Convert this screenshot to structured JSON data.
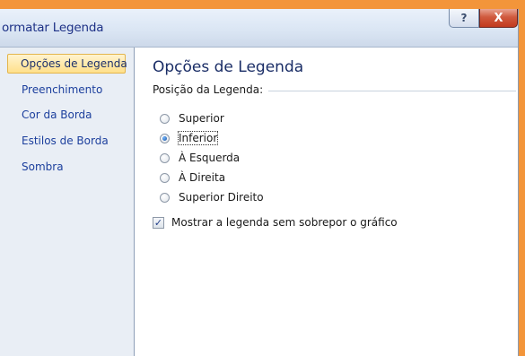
{
  "window": {
    "title": "ormatar Legenda",
    "help_label": "?",
    "close_label": "X"
  },
  "sidebar": {
    "items": [
      {
        "label": "Opções de Legenda",
        "selected": true
      },
      {
        "label": "Preenchimento",
        "selected": false
      },
      {
        "label": "Cor da Borda",
        "selected": false
      },
      {
        "label": "Estilos de Borda",
        "selected": false
      },
      {
        "label": "Sombra",
        "selected": false
      }
    ]
  },
  "main": {
    "title": "Opções de Legenda",
    "group_label": "Posição da Legenda:",
    "options": [
      {
        "label": "Superior",
        "checked": false
      },
      {
        "label": "Inferior",
        "checked": true
      },
      {
        "label": "À Esquerda",
        "checked": false
      },
      {
        "label": "À Direita",
        "checked": false
      },
      {
        "label": "Superior Direito",
        "checked": false
      }
    ],
    "overlap_checkbox": {
      "label": "Mostrar a legenda sem sobrepor o gráfico",
      "checked": true
    }
  },
  "colors": {
    "background": "#f3953a",
    "link_blue": "#1c3f9d",
    "selected_bg": "#ffe08a"
  }
}
